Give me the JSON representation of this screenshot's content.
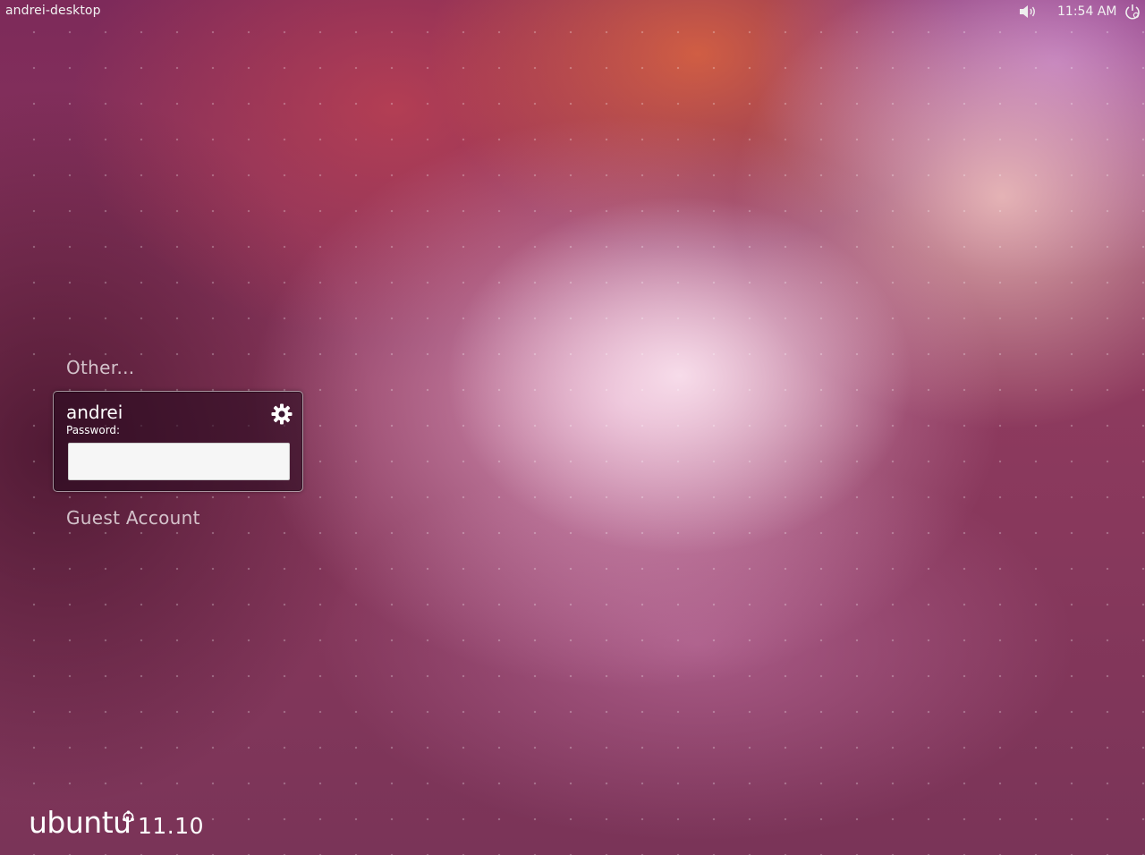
{
  "top_panel": {
    "hostname": "andrei-desktop",
    "clock": "11:54 AM",
    "icons": [
      "volume-icon",
      "power-icon"
    ]
  },
  "login": {
    "other_label": "Other...",
    "selected_user": "andrei",
    "password_label": "Password:",
    "password_value": "",
    "guest_label": "Guest Account",
    "session_icon": "gear-icon"
  },
  "branding": {
    "wordmark": "ubuntu",
    "version": "11.10",
    "mark_icon": "circle-of-friends-icon"
  },
  "colors": {
    "panel_text": "#f2f2f2",
    "background_base": "#7a2a55",
    "login_box_bg": "#280a1e",
    "input_bg": "#f6f6f6"
  }
}
